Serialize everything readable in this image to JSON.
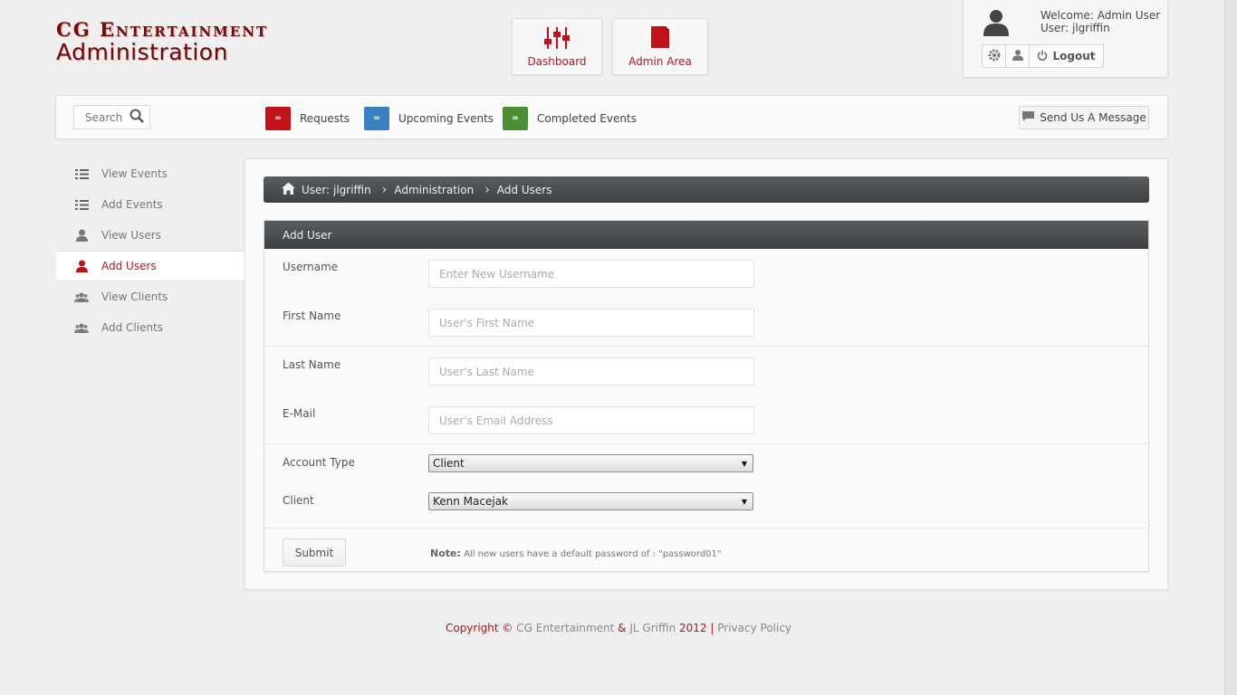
{
  "logo": {
    "line1": "CG Entertainment",
    "line2": "Administration"
  },
  "top_tiles": {
    "dashboard_label": "Dashboard",
    "admin_label": "Admin Area"
  },
  "user_panel": {
    "welcome": "Welcome: Admin User",
    "user": "User: jlgriffin",
    "logout_label": "Logout"
  },
  "navbar": {
    "search_placeholder": "Search",
    "items": [
      {
        "label": "Requests",
        "badge": "∞",
        "color": "#c1121a"
      },
      {
        "label": "Upcoming Events",
        "badge": "∞",
        "color": "#3a7fc1"
      },
      {
        "label": "Completed Events",
        "badge": "∞",
        "color": "#4b8f34"
      }
    ],
    "send_message_label": "Send Us A Message"
  },
  "sidebar": {
    "items": [
      {
        "label": "View Events",
        "icon": "list-icon"
      },
      {
        "label": "Add Events",
        "icon": "list-icon"
      },
      {
        "label": "View Users",
        "icon": "user-icon"
      },
      {
        "label": "Add Users",
        "icon": "user-icon",
        "active": true
      },
      {
        "label": "View Clients",
        "icon": "group-icon"
      },
      {
        "label": "Add Clients",
        "icon": "group-icon"
      }
    ]
  },
  "breadcrumb": {
    "items": [
      "User: jlgriffin",
      "Administration",
      "Add Users"
    ]
  },
  "form": {
    "title": "Add User",
    "fields": {
      "username": {
        "label": "Username",
        "placeholder": "Enter New Username",
        "value": ""
      },
      "first_name": {
        "label": "First Name",
        "placeholder": "User's First Name",
        "value": ""
      },
      "last_name": {
        "label": "Last Name",
        "placeholder": "User's Last Name",
        "value": ""
      },
      "email": {
        "label": "E-Mail",
        "placeholder": "User's Email Address",
        "value": ""
      },
      "account_type": {
        "label": "Account Type",
        "selected": "Client"
      },
      "client": {
        "label": "Client",
        "selected": "Kenn Macejak"
      }
    },
    "submit_label": "Submit",
    "note_label": "Note:",
    "note_text": "All new users have a default password of :  \"password01\""
  },
  "footer": {
    "copyright": "Copyright ©",
    "company": "CG Entertainment",
    "amp": "&",
    "person": "JL Griffin",
    "year": "2012",
    "sep": "|",
    "privacy": "Privacy Policy"
  },
  "colors": {
    "brand_red": "#c1121a",
    "header_dark": "#3e4144"
  }
}
